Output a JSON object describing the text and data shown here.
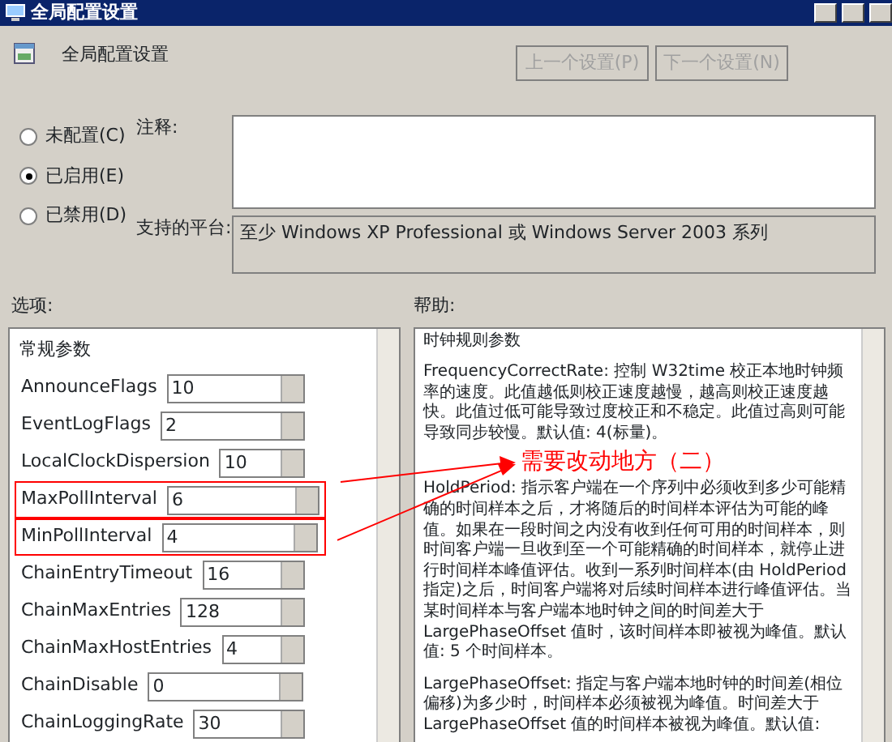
{
  "window": {
    "title": "全局配置设置"
  },
  "header": {
    "title": "全局配置设置",
    "buttons": [
      {
        "label": "上一个设置(P)",
        "disabled": true
      },
      {
        "label": "下一个设置(N)",
        "disabled": true
      }
    ]
  },
  "state_options": [
    {
      "label": "未配置(C)",
      "selected": false
    },
    {
      "label": "已启用(E)",
      "selected": true
    },
    {
      "label": "已禁用(D)",
      "selected": false
    }
  ],
  "comment": {
    "label": "注释:"
  },
  "platform": {
    "label": "支持的平台:",
    "value": "至少 Windows XP Professional 或 Windows Server 2003 系列"
  },
  "options": {
    "label": "选项:",
    "section": "常规参数",
    "params": [
      {
        "name": "AnnounceFlags",
        "value": "10",
        "highlighted": false
      },
      {
        "name": "EventLogFlags",
        "value": "2",
        "highlighted": false
      },
      {
        "name": "LocalClockDispersion",
        "value": "10",
        "highlighted": false
      },
      {
        "name": "MaxPollInterval",
        "value": "6",
        "highlighted": true
      },
      {
        "name": "MinPollInterval",
        "value": "4",
        "highlighted": true
      },
      {
        "name": "ChainEntryTimeout",
        "value": "16",
        "highlighted": false
      },
      {
        "name": "ChainMaxEntries",
        "value": "128",
        "highlighted": false
      },
      {
        "name": "ChainMaxHostEntries",
        "value": "4",
        "highlighted": false
      },
      {
        "name": "ChainDisable",
        "value": "0",
        "highlighted": false
      },
      {
        "name": "ChainLoggingRate",
        "value": "30",
        "highlighted": false
      }
    ]
  },
  "help": {
    "label": "帮助:",
    "paragraphs": [
      "时钟规则参数",
      "FrequencyCorrectRate: 控制 W32time 校正本地时钟频率的速度。此值越低则校正速度越慢，越高则校正速度越快。此值过低可能导致过度校正和不稳定。此值过高则可能导致同步较慢。默认值: 4(标量)。",
      "HoldPeriod: 指示客户端在一个序列中必须收到多少可能精确的时间样本之后，才将随后的时间样本评估为可能的峰值。如果在一段时间之内没有收到任何可用的时间样本，则时间客户端一旦收到至一个可能精确的时间样本，就停止进行时间样本峰值评估。收到一系列时间样本(由 HoldPeriod 指定)之后，时间客户端将对后续时间样本进行峰值评估。当某时间样本与客户端本地时钟之间的时间差大于 LargePhaseOffset 值时，该时间样本即被视为峰值。默认值: 5 个时间样本。",
      "LargePhaseOffset: 指定与客户端本地时钟的时间差(相位偏移)为多少时，时间样本必须被视为峰值。时间差大于 LargePhaseOffset 值的时间样本被视为峰值。默认值:"
    ]
  },
  "annotation": {
    "text": "需要改动地方（二）"
  }
}
